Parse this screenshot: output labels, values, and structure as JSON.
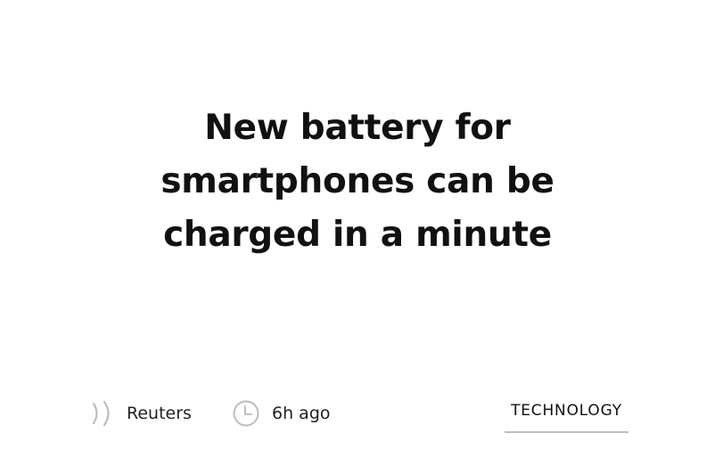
{
  "article": {
    "headline": "New battery for smartphones can be charged in a minute",
    "source": "Reuters",
    "time_ago": "6h ago",
    "category": "TECHNOLOGY"
  },
  "icons": {
    "source": "broadcast-icon",
    "time": "clock-icon"
  },
  "colors": {
    "text": "#111111",
    "icon": "#bdbdbd",
    "underline": "#bdbdbd",
    "background": "#ffffff"
  }
}
